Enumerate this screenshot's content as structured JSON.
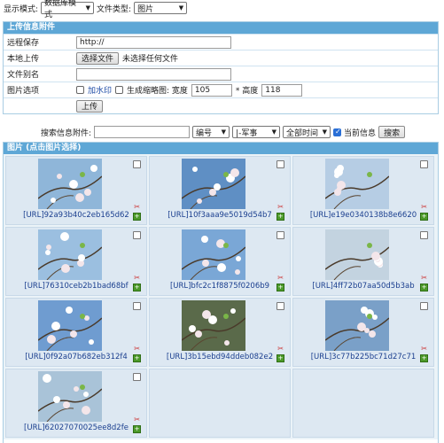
{
  "topbar": {
    "display_mode_label": "显示模式:",
    "display_mode_value": "数据库模式",
    "file_type_label": "文件类型:",
    "file_type_value": "图片"
  },
  "upload": {
    "title": "上传信息附件",
    "remote_label": "远程保存",
    "remote_value": "http://",
    "local_label": "本地上传",
    "choose_file_button": "选择文件",
    "no_file_text": "未选择任何文件",
    "alias_label": "文件别名",
    "alias_value": "",
    "image_options_label": "图片选项",
    "watermark_label": "加水印",
    "thumbnail_label": "生成缩略图: 宽度",
    "width_value": "105",
    "height_label": "* 高度",
    "height_value": "118",
    "upload_button": "上传"
  },
  "search": {
    "label": "搜索信息附件:",
    "query_value": "",
    "field_value": "编号",
    "category_value": "|-军事",
    "time_value": "全部时间",
    "current_info_label": "当前信息",
    "search_button": "搜索"
  },
  "gallery": {
    "title": "图片 (点击图片选择)",
    "items": [
      {
        "caption": "[URL]92a93b40c2eb165d62"
      },
      {
        "caption": "[URL]10f3aaa9e5019d54b7"
      },
      {
        "caption": "[URL]e19e0340138b8e6620"
      },
      {
        "caption": "[URL]76310ceb2b1bad68bf"
      },
      {
        "caption": "[URL]bfc2c1f8875f0206b9"
      },
      {
        "caption": "[URL]4ff72b07aa50d5b3ab"
      },
      {
        "caption": "[URL]0f92a07b682eb312f4"
      },
      {
        "caption": "[URL]3b15ebd94ddeb082e2"
      },
      {
        "caption": "[URL]3c77b225bc71d27c71"
      },
      {
        "caption": "[URL]62027070025ee8d2fe"
      }
    ]
  }
}
